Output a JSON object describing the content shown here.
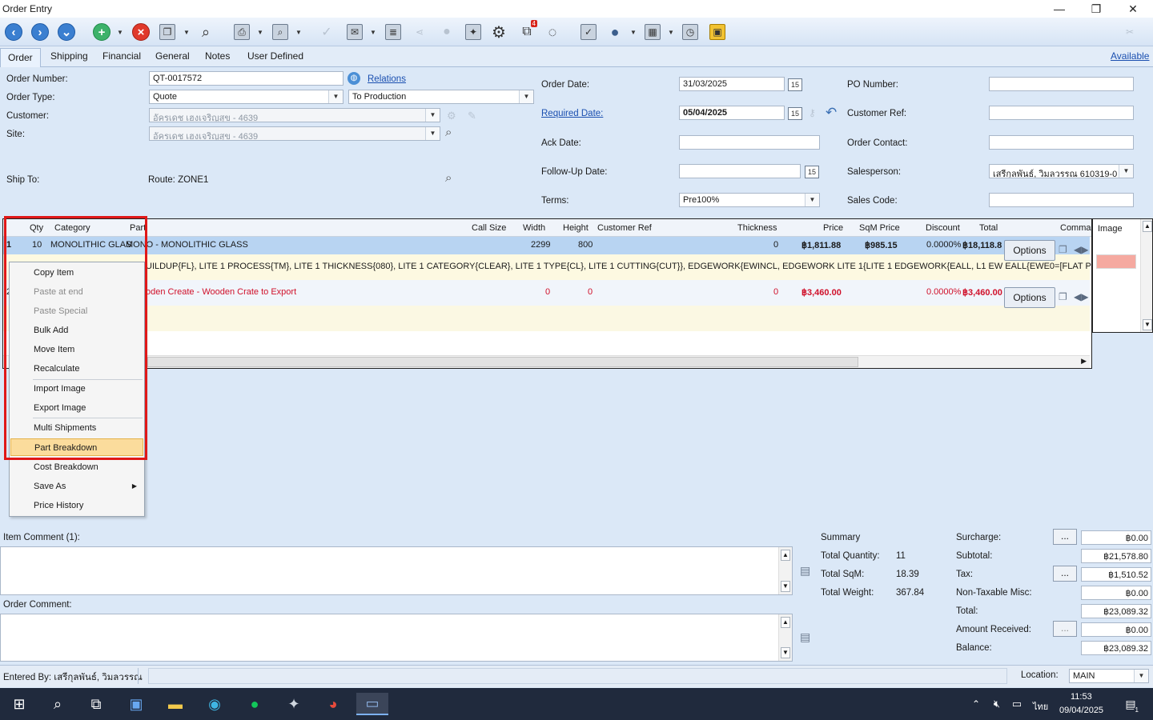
{
  "window": {
    "title": "Order Entry",
    "min": "—",
    "restore": "❐",
    "close": "✕"
  },
  "toolbar": {
    "icons": [
      "back-icon",
      "forward-icon",
      "download-icon",
      "add-icon",
      "delete-icon",
      "copy-icon",
      "search-icon",
      "print-icon",
      "preview-icon",
      "check-icon",
      "email-icon",
      "report-icon",
      "share-icon",
      "user-icon",
      "wizard-icon",
      "settings-icon",
      "attachment-icon",
      "chat-icon",
      "clipboard-icon",
      "contact-icon",
      "gallery-icon",
      "schedule-icon",
      "lock-icon",
      "tools-icon"
    ],
    "attachment_count": "4"
  },
  "tabs": [
    "Order",
    "Shipping",
    "Financial",
    "General",
    "Notes",
    "User Defined"
  ],
  "available_link": "Available",
  "header": {
    "order_number_label": "Order Number:",
    "order_number": "QT-0017572",
    "relations_link": "Relations",
    "order_type_label": "Order Type:",
    "order_type": "Quote",
    "order_type2": "To Production",
    "customer_label": "Customer:",
    "customer": "อัครเดช เฮงเจริญสุข - 4639",
    "site_label": "Site:",
    "site": "อัครเดช เฮงเจริญสุข - 4639",
    "ship_to_label": "Ship To:",
    "route": "Route: ZONE1",
    "order_date_label": "Order Date:",
    "order_date": "31/03/2025",
    "required_date_label": "Required Date:",
    "required_date": "05/04/2025",
    "ack_date_label": "Ack Date:",
    "followup_label": "Follow-Up Date:",
    "terms_label": "Terms:",
    "terms": "Pre100%",
    "po_label": "PO Number:",
    "cust_ref_label": "Customer Ref:",
    "contact_label": "Order Contact:",
    "salesperson_label": "Salesperson:",
    "salesperson": "เสรีกุลพันธ์, วิมลวรรณ 610319-0",
    "sales_code_label": "Sales Code:",
    "cal_day": "15"
  },
  "grid": {
    "columns": [
      "Qty",
      "Category",
      "Part",
      "Call Size",
      "Width",
      "Height",
      "Customer Ref",
      "Thickness",
      "Price",
      "SqM Price",
      "Discount",
      "Total",
      "Comman",
      "Image"
    ],
    "row1": {
      "num": "1",
      "qty": "10",
      "category": "MONOLITHIC GLAS",
      "part": "MONO - MONOLITHIC GLASS",
      "width": "2299",
      "height": "800",
      "thickness": "0",
      "price": "฿1,811.88",
      "sqm": "฿985.15",
      "discount": "0.0000%",
      "total": "฿18,118.8",
      "detail": "UILDUP{FL}, LITE 1 PROCESS{TM}, LITE 1 THICKNESS{080}, LITE 1 CATEGORY{CLEAR}, LITE 1 TYPE{CL}, LITE 1 CUTTING{CUT}}, EDGEWORK{EWINCL, EDGEWORK LITE 1{LITE 1 EDGEWORK{EALL, L1 EW EALL{EWE0=[FLAT POLISHED]}}}}"
    },
    "row2": {
      "num": "2",
      "part": "oden Create - Wooden Crate to Export",
      "width": "0",
      "height": "0",
      "thickness": "0",
      "price": "฿3,460.00",
      "discount": "0.0000%",
      "total": "฿3,460.00"
    },
    "options": "Options"
  },
  "context_menu": [
    "Copy Item",
    "Paste at end",
    "Paste Special",
    "Bulk Add",
    "Move Item",
    "Recalculate",
    "Import Image",
    "Export Image",
    "Multi Shipments",
    "Part Breakdown",
    "Cost Breakdown",
    "Save As",
    "Price History"
  ],
  "comments": {
    "item_label": "Item Comment (1):",
    "order_label": "Order Comment:"
  },
  "summary": {
    "title": "Summary",
    "qty_label": "Total Quantity:",
    "qty": "11",
    "sqm_label": "Total SqM:",
    "sqm": "18.39",
    "weight_label": "Total Weight:",
    "weight": "367.84"
  },
  "totals": {
    "surcharge_label": "Surcharge:",
    "surcharge": "฿0.00",
    "subtotal_label": "Subtotal:",
    "subtotal": "฿21,578.80",
    "tax_label": "Tax:",
    "tax": "฿1,510.52",
    "ntm_label": "Non-Taxable Misc:",
    "ntm": "฿0.00",
    "total_label": "Total:",
    "total": "฿23,089.32",
    "received_label": "Amount Received:",
    "received": "฿0.00",
    "balance_label": "Balance:",
    "balance": "฿23,089.32",
    "ellipsis": "..."
  },
  "status": {
    "entered_by": "Entered By: เสรีกุลพันธ์, วิมลวรรณ",
    "location_label": "Location:",
    "location": "MAIN"
  },
  "taskbar": {
    "time": "11:53",
    "date": "09/04/2025",
    "lang": "ไทย",
    "notif": "1"
  }
}
